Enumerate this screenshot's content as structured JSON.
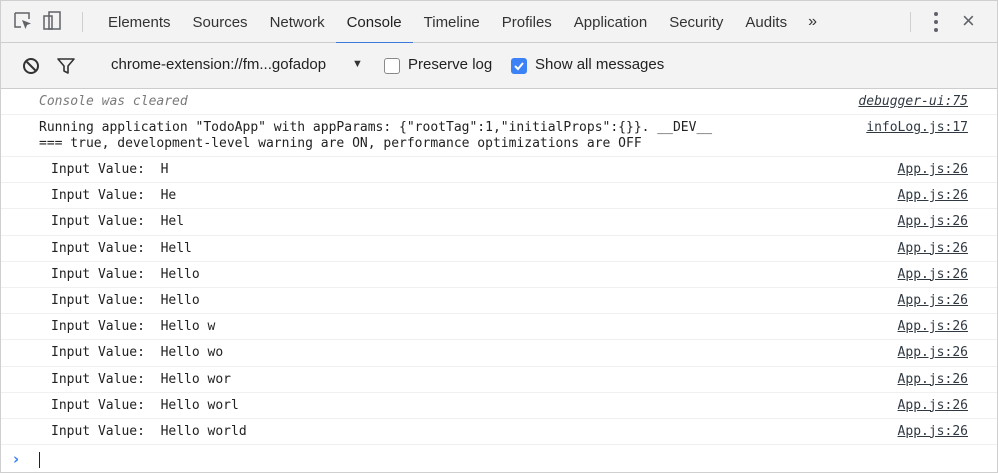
{
  "tabs": [
    "Elements",
    "Sources",
    "Network",
    "Console",
    "Timeline",
    "Profiles",
    "Application",
    "Security",
    "Audits"
  ],
  "active_tab": "Console",
  "more_tabs_label": "»",
  "close_label": "×",
  "toolbar": {
    "context": "chrome-extension://fm...gofadop",
    "context_arrow": "▼",
    "preserve_log_label": "Preserve log",
    "preserve_log_checked": false,
    "show_all_label": "Show all messages",
    "show_all_checked": true
  },
  "console": {
    "cleared": {
      "text": "Console was cleared",
      "source": "debugger-ui:75"
    },
    "app_info": {
      "line1": "Running application \"TodoApp\" with appParams: {\"rootTag\":1,\"initialProps\":{}}. __DEV__",
      "line2": "=== true, development-level warning are ON, performance optimizations are OFF",
      "source": "infoLog.js:17"
    },
    "logs": [
      {
        "text": "Input Value:  H",
        "source": "App.js:26"
      },
      {
        "text": "Input Value:  He",
        "source": "App.js:26"
      },
      {
        "text": "Input Value:  Hel",
        "source": "App.js:26"
      },
      {
        "text": "Input Value:  Hell",
        "source": "App.js:26"
      },
      {
        "text": "Input Value:  Hello",
        "source": "App.js:26"
      },
      {
        "text": "Input Value:  Hello",
        "source": "App.js:26"
      },
      {
        "text": "Input Value:  Hello w",
        "source": "App.js:26"
      },
      {
        "text": "Input Value:  Hello wo",
        "source": "App.js:26"
      },
      {
        "text": "Input Value:  Hello wor",
        "source": "App.js:26"
      },
      {
        "text": "Input Value:  Hello worl",
        "source": "App.js:26"
      },
      {
        "text": "Input Value:  Hello world",
        "source": "App.js:26"
      }
    ],
    "prompt_symbol": "›"
  },
  "colors": {
    "accent": "#3879d9",
    "checkbox": "#3b82f6",
    "toolbar_bg": "#f3f3f3"
  }
}
